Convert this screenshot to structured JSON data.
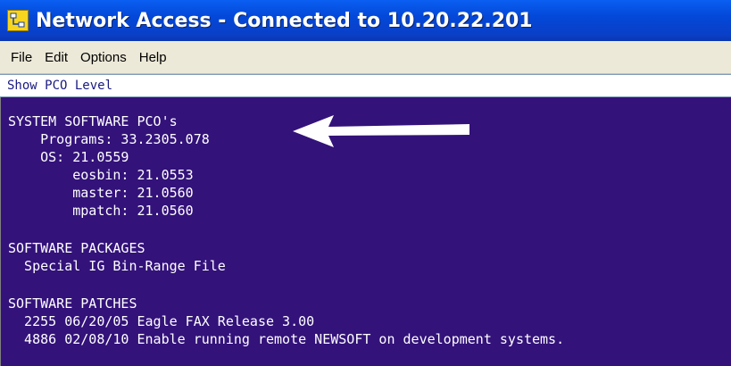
{
  "window": {
    "title": "Network Access - Connected to 10.20.22.201",
    "icon": "network-app-icon"
  },
  "menu": {
    "items": [
      "File",
      "Edit",
      "Options",
      "Help"
    ]
  },
  "command": {
    "text": "Show PCO Level"
  },
  "terminal": {
    "background": "#33127a",
    "lines": [
      "SYSTEM SOFTWARE PCO's",
      "    Programs: 33.2305.078",
      "    OS: 21.0559",
      "        eosbin: 21.0553",
      "        master: 21.0560",
      "        mpatch: 21.0560",
      "",
      "SOFTWARE PACKAGES",
      "  Special IG Bin-Range File",
      "",
      "SOFTWARE PATCHES",
      "  2255 06/20/05 Eagle FAX Release 3.00",
      "  4886 02/08/10 Enable running remote NEWSOFT on development systems."
    ]
  },
  "annotation": {
    "icon": "left-arrow-icon",
    "color": "#ffffff"
  }
}
